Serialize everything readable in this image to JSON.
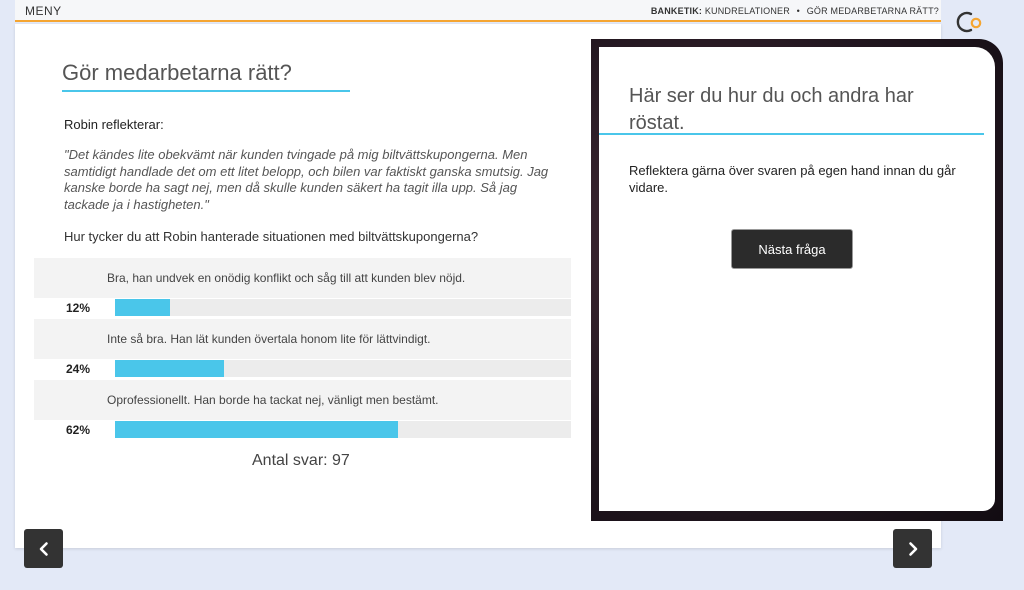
{
  "header": {
    "menu_label": "MENY",
    "course_label": "BANKETIK:",
    "section_label": "KUNDRELATIONER",
    "separator": "•",
    "page_label": "GÖR MEDARBETARNA RÄTT?"
  },
  "logo": {
    "icon": "brand-logo-icon",
    "colors": [
      "#333333",
      "#f5a531"
    ]
  },
  "main": {
    "title": "Gör medarbetarna rätt?",
    "speaker": "Robin reflekterar:",
    "quote": "\"Det kändes lite obekvämt när kunden tvingade på mig biltvättskupongerna. Men samtidigt handlade det om ett litet belopp, och bilen var faktiskt ganska smutsig. Jag kanske borde ha sagt nej, men då skulle kunden säkert ha tagit illa upp. Så jag tackade ja i hastigheten.\"",
    "question": "Hur tycker du att Robin hanterade situationen med biltvättskupongerna?",
    "options": [
      {
        "text": "Bra, han undvek en onödig konflikt och såg till att kunden blev nöjd.",
        "percent_label": "12%",
        "percent": 12
      },
      {
        "text": "Inte så bra. Han lät kunden övertala honom lite för lättvindigt.",
        "percent_label": "24%",
        "percent": 24
      },
      {
        "text": "Oprofessionellt. Han borde ha tackat nej, vänligt men bestämt.",
        "percent_label": "62%",
        "percent": 62
      }
    ],
    "total_label": "Antal svar: 97"
  },
  "panel": {
    "title": "Här ser du hur du och andra har röstat.",
    "text": "Reflektera gärna över svaren på egen hand innan du går vidare.",
    "button_label": "Nästa fråga"
  },
  "nav": {
    "prev_icon": "chevron-left-icon",
    "next_icon": "chevron-right-icon"
  },
  "colors": {
    "accent": "#4ac6ea",
    "highlight": "#f5a531",
    "background": "#e3e9f7",
    "button": "#2b2b2b"
  }
}
